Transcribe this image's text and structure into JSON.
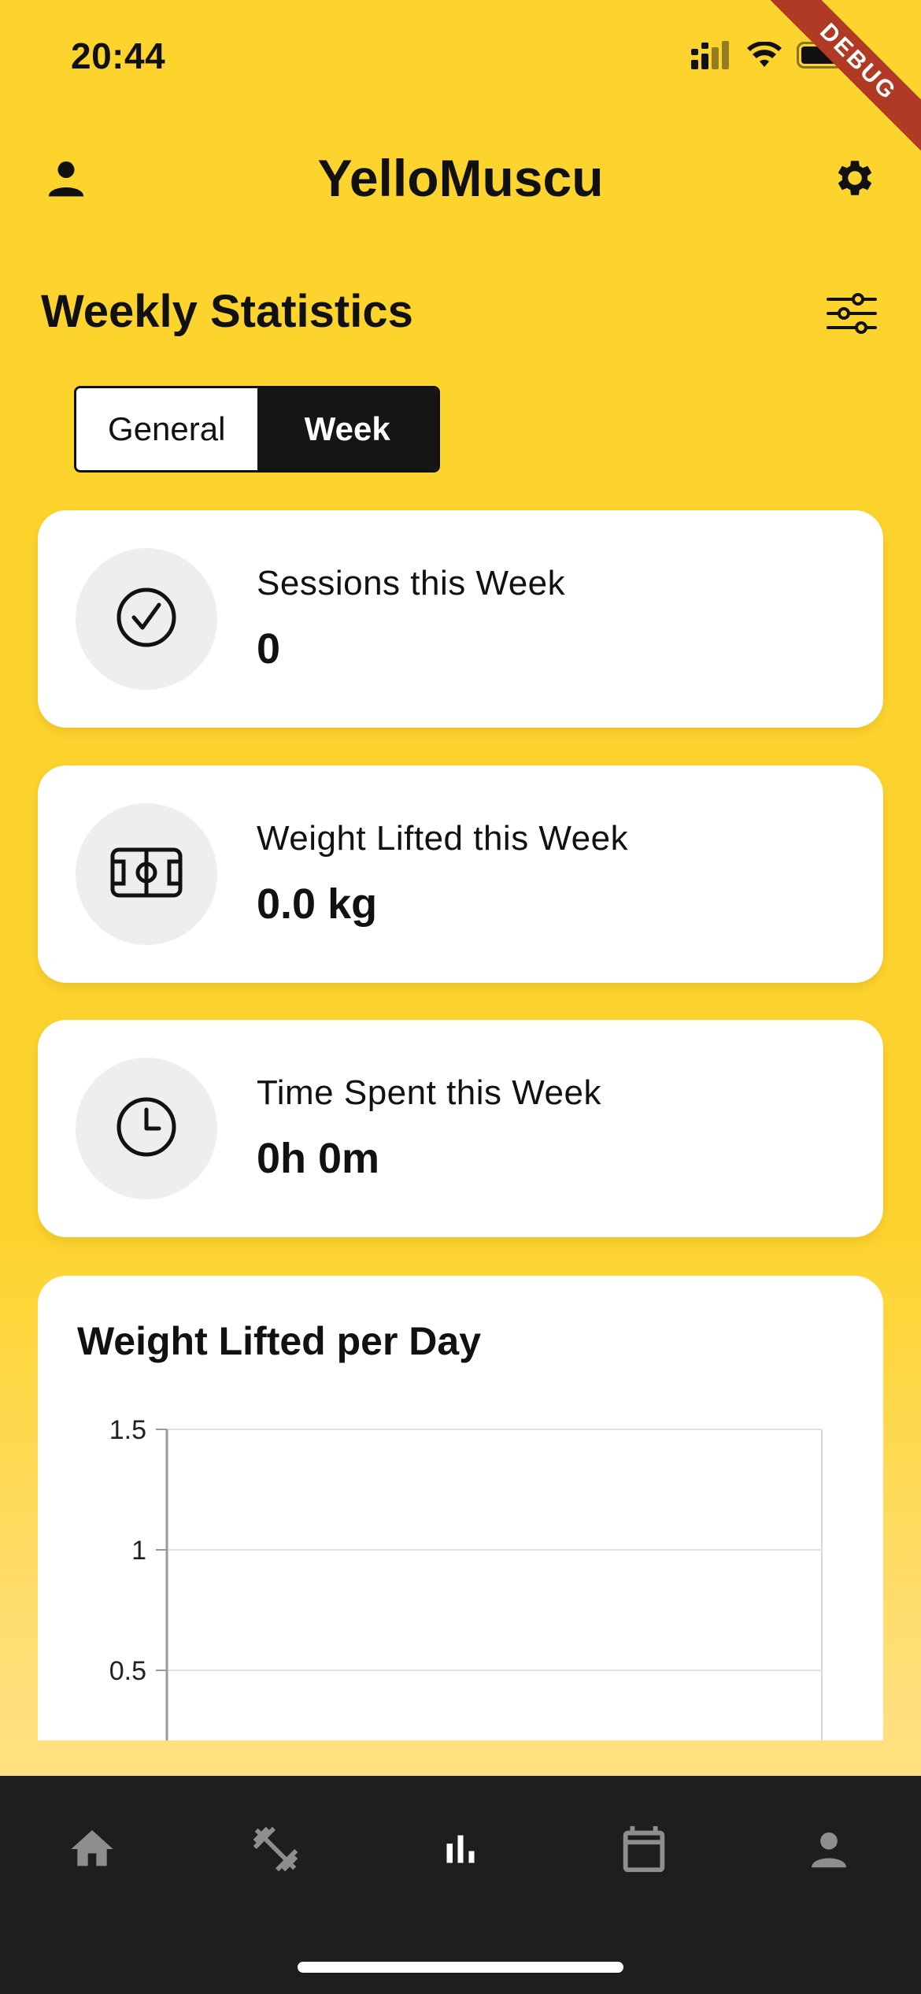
{
  "status_bar": {
    "time": "20:44",
    "debug_label": "DEBUG"
  },
  "header": {
    "title": "YelloMuscu",
    "left_icon": "person-icon",
    "right_icon": "gear-icon"
  },
  "section": {
    "title": "Weekly Statistics",
    "filter_icon": "sliders-icon"
  },
  "tabs": [
    {
      "label": "General",
      "active": false
    },
    {
      "label": "Week",
      "active": true
    }
  ],
  "stats": [
    {
      "label": "Sessions this Week",
      "value": "0",
      "icon": "check-circle-icon"
    },
    {
      "label": "Weight Lifted this Week",
      "value": "0.0 kg",
      "icon": "barbell-icon"
    },
    {
      "label": "Time Spent this Week",
      "value": "0h 0m",
      "icon": "clock-icon"
    }
  ],
  "chart": {
    "title": "Weight Lifted per Day"
  },
  "chart_data": {
    "type": "bar",
    "title": "Weight Lifted per Day",
    "xlabel": "",
    "ylabel": "",
    "y_ticks": [
      "1.5",
      "1",
      "0.5"
    ],
    "ylim": [
      0,
      1.5
    ],
    "categories": [],
    "values": [],
    "grid": true
  },
  "bottom_nav": [
    {
      "icon": "home-icon",
      "active": false
    },
    {
      "icon": "dumbbell-icon",
      "active": false
    },
    {
      "icon": "bar-chart-icon",
      "active": true
    },
    {
      "icon": "calendar-icon",
      "active": false
    },
    {
      "icon": "person-icon",
      "active": false
    }
  ],
  "colors": {
    "accent": "#FDD42E",
    "nav_bg": "#1E1E1E",
    "nav_inactive": "#8E8E8E",
    "nav_active": "#FFFFFF"
  }
}
